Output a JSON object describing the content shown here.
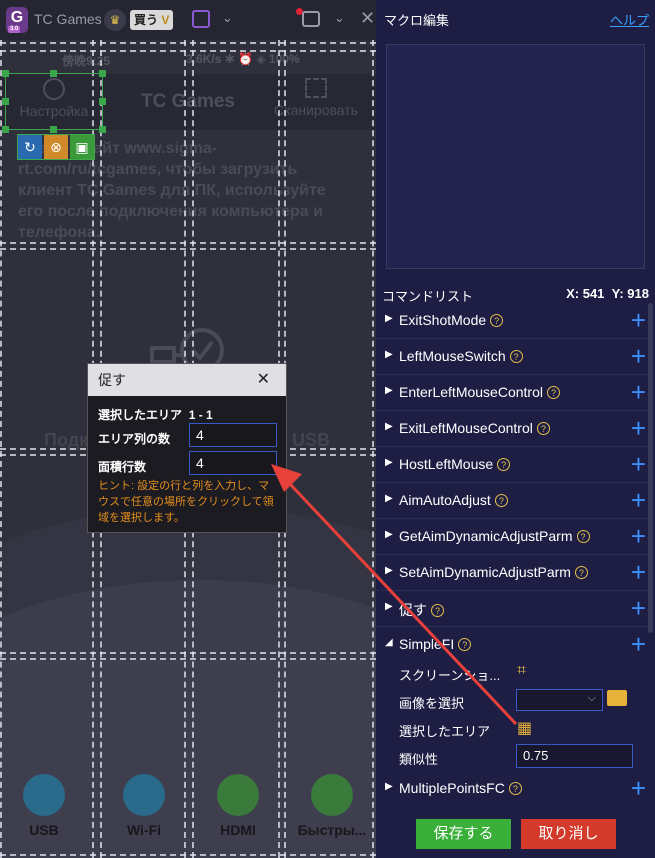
{
  "window": {
    "logo_text": "G",
    "logo_version": "3.0",
    "app_name": "TC Games",
    "buy_label": "買う",
    "crown_glyph": "♛",
    "close_glyph": "✕"
  },
  "phone": {
    "status_time": "傍晚9:25",
    "status_right": "3.6K/s ✱ ⏰ ◈ 100%",
    "settings_label": "Настройка",
    "app_title": "TC Games",
    "scan_label": "Сканировать",
    "body_text": "Сте веб-сайт www.sigma-rt.com/ru/tcgames, чтобы загрузить клиент TC Games для ПК, используйте его после подключения компьютера и телефона.",
    "mid_left": "Подк",
    "mid_right": "USB",
    "connections": [
      {
        "label": "USB",
        "color": "#2a6a8a",
        "icon": "usb-icon"
      },
      {
        "label": "Wi-Fi",
        "color": "#2a6a8a",
        "icon": "wifi-icon"
      },
      {
        "label": "HDMI",
        "color": "#3a7a3a",
        "icon": "monitor-icon"
      },
      {
        "label": "Быстры...",
        "color": "#3a7a3a",
        "icon": "projector-icon"
      }
    ]
  },
  "dialog": {
    "title": "促す",
    "close": "✕",
    "selected_area_label": "選択したエリア",
    "selected_area_value": "1 - 1",
    "cols_label": "エリア列の数",
    "cols_value": "4",
    "rows_label": "面積行数",
    "rows_value": "4",
    "hint": "ヒント: 設定の行と列を入力し、マウスで任意の場所をクリックして領域を選択します。"
  },
  "panel": {
    "title": "マクロ編集",
    "help": "ヘルプ",
    "command_list_label": "コマンドリスト",
    "coord_x": "X: 541",
    "coord_y": "Y: 918",
    "commands": [
      {
        "name": "ExitShotMode",
        "expanded": false
      },
      {
        "name": "LeftMouseSwitch",
        "expanded": false
      },
      {
        "name": "EnterLeftMouseControl",
        "expanded": false
      },
      {
        "name": "ExitLeftMouseControl",
        "expanded": false
      },
      {
        "name": "HostLeftMouse",
        "expanded": false
      },
      {
        "name": "AimAutoAdjust",
        "expanded": false
      },
      {
        "name": "GetAimDynamicAdjustParm",
        "expanded": false
      },
      {
        "name": "SetAimDynamicAdjustParm",
        "expanded": false
      },
      {
        "name": "促す",
        "expanded": false
      },
      {
        "name": "SimpleFI",
        "expanded": true
      },
      {
        "name": "MultiplePointsFC",
        "expanded": false
      }
    ],
    "simplefi": {
      "screenshot_label": "スクリーンショ...",
      "image_label": "画像を選択",
      "area_label": "選択したエリア",
      "similarity_label": "類似性",
      "similarity_value": "0.75"
    },
    "save": "保存する",
    "cancel": "取り消し"
  },
  "colors": {
    "accent_blue": "#3a8fff",
    "save_green": "#3ab03a",
    "cancel_red": "#d43a2a",
    "hint_orange": "#e6901a",
    "arrow_red": "#e8403a"
  }
}
